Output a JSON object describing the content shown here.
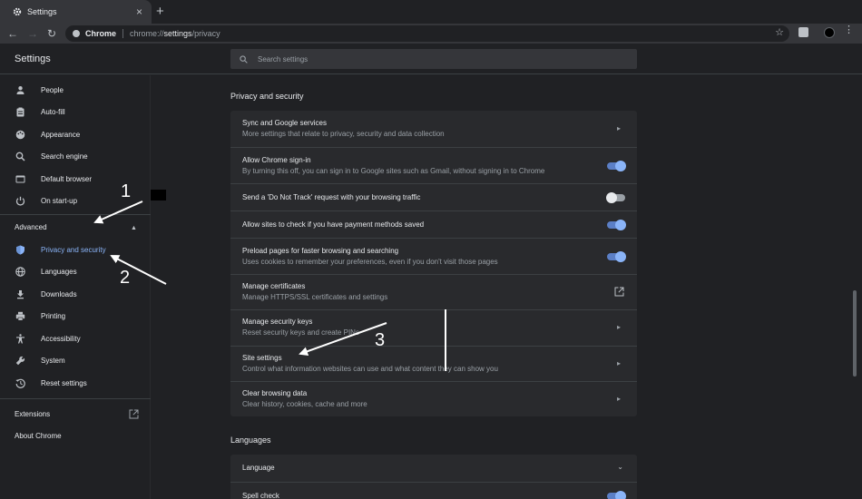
{
  "browser": {
    "tab_title": "Settings",
    "omnibox_chip": "Chrome",
    "url_prefix": "chrome://",
    "url_host": "settings",
    "url_path": "/privacy"
  },
  "header": {
    "title": "Settings",
    "search_placeholder": "Search settings"
  },
  "sidebar": {
    "items": [
      {
        "label": "People",
        "icon": "person-icon"
      },
      {
        "label": "Auto-fill",
        "icon": "clipboard-icon"
      },
      {
        "label": "Appearance",
        "icon": "palette-icon"
      },
      {
        "label": "Search engine",
        "icon": "search-icon"
      },
      {
        "label": "Default browser",
        "icon": "browser-icon"
      },
      {
        "label": "On start-up",
        "icon": "power-icon"
      }
    ],
    "advanced_heading": "Advanced",
    "advanced_items": [
      {
        "label": "Privacy and security",
        "icon": "shield-icon",
        "active": true
      },
      {
        "label": "Languages",
        "icon": "globe-icon"
      },
      {
        "label": "Downloads",
        "icon": "download-icon"
      },
      {
        "label": "Printing",
        "icon": "printer-icon"
      },
      {
        "label": "Accessibility",
        "icon": "accessibility-icon"
      },
      {
        "label": "System",
        "icon": "wrench-icon"
      },
      {
        "label": "Reset settings",
        "icon": "history-icon"
      }
    ],
    "extensions": "Extensions",
    "about": "About Chrome"
  },
  "privacy": {
    "title": "Privacy and security",
    "rows": [
      {
        "title": "Sync and Google services",
        "subtitle": "More settings that relate to privacy, security and data collection",
        "control": "arrow"
      },
      {
        "title": "Allow Chrome sign-in",
        "subtitle": "By turning this off, you can sign in to Google sites such as Gmail, without signing in to Chrome",
        "control": "toggle",
        "on": true
      },
      {
        "title": "Send a 'Do Not Track' request with your browsing traffic",
        "control": "toggle",
        "on": false
      },
      {
        "title": "Allow sites to check if you have payment methods saved",
        "control": "toggle",
        "on": true
      },
      {
        "title": "Preload pages for faster browsing and searching",
        "subtitle": "Uses cookies to remember your preferences, even if you don't visit those pages",
        "control": "toggle",
        "on": true
      },
      {
        "title": "Manage certificates",
        "subtitle": "Manage HTTPS/SSL certificates and settings",
        "control": "external"
      },
      {
        "title": "Manage security keys",
        "subtitle": "Reset security keys and create PINs",
        "control": "arrow"
      },
      {
        "title": "Site settings",
        "subtitle": "Control what information websites can use and what content they can show you",
        "control": "arrow"
      },
      {
        "title": "Clear browsing data",
        "subtitle": "Clear history, cookies, cache and more",
        "control": "arrow"
      }
    ]
  },
  "languages": {
    "title": "Languages",
    "rows": [
      {
        "title": "Language",
        "control": "dropdown"
      },
      {
        "title": "Spell check",
        "control": "toggle",
        "on": true
      }
    ]
  },
  "annotations": [
    "1",
    "2",
    "3"
  ],
  "colors": {
    "background": "#202124",
    "card": "#292a2d",
    "accent": "#8ab4f8",
    "text": "#e8eaed",
    "secondary_text": "#9aa0a6"
  }
}
